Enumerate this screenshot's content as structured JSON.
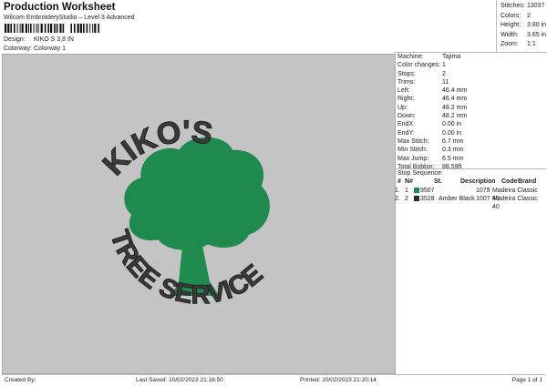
{
  "header": {
    "title": "Production Worksheet",
    "subtitle": "Wilcom EmbroideryStudio – Level 3 Advanced",
    "design_label": "Design:",
    "design_value": "KIKO S 3,8 IN",
    "colorway_label": "Colorway:",
    "colorway_value": "Colorway 1"
  },
  "stats": [
    {
      "k": "Stitches:",
      "v": "13037"
    },
    {
      "k": "Colors:",
      "v": "2"
    },
    {
      "k": "Height:",
      "v": "3.80 in"
    },
    {
      "k": "Width:",
      "v": "3.65 in"
    },
    {
      "k": "Zoom:",
      "v": "1:1"
    }
  ],
  "properties": [
    {
      "k": "Machine:",
      "v": "Tajima"
    },
    {
      "k": "Color changes:",
      "v": "1"
    },
    {
      "k": "Stops:",
      "v": "2"
    },
    {
      "k": "Trims:",
      "v": "11"
    },
    {
      "k": "Left:",
      "v": "46.4 mm"
    },
    {
      "k": "Right:",
      "v": "46.4 mm"
    },
    {
      "k": "Up:",
      "v": "48.2 mm"
    },
    {
      "k": "Down:",
      "v": "48.2 mm"
    },
    {
      "k": "EndX:",
      "v": "0.00 in"
    },
    {
      "k": "EndY:",
      "v": "0.00 in"
    },
    {
      "k": "Max Stitch:",
      "v": "6.7 mm"
    },
    {
      "k": "Min Stitch:",
      "v": "0.3 mm"
    },
    {
      "k": "Max Jump:",
      "v": "6.5 mm"
    },
    {
      "k": "Total Bobbin:",
      "v": "88.59ft"
    }
  ],
  "stop_sequence": {
    "title": "Stop Sequence:",
    "headers": [
      "#",
      "N#",
      "St.",
      "Description",
      "Code",
      "Brand"
    ],
    "rows": [
      {
        "idx": "1.",
        "n": "1",
        "color": "#1e8a4e",
        "st": "9507",
        "desc": "",
        "code": "1079",
        "brand": "Madeira Classic 40"
      },
      {
        "idx": "2.",
        "n": "2",
        "color": "#2a2a2a",
        "st": "3528",
        "desc": "Amber Black",
        "code": "1007",
        "brand": "Madeira Classic 40"
      }
    ]
  },
  "design": {
    "top_text": "KIKO'S",
    "bottom_text": "TREE SERVICE",
    "tree_color": "#1e8a4e",
    "text_color": "#3a3a3a"
  },
  "footer": {
    "created_by": "Created By:",
    "last_saved": "Last Saved: 10/02/2023 21:16:50",
    "printed": "Printed: 10/02/2023 21:20:14",
    "page": "Page 1 of 1"
  }
}
